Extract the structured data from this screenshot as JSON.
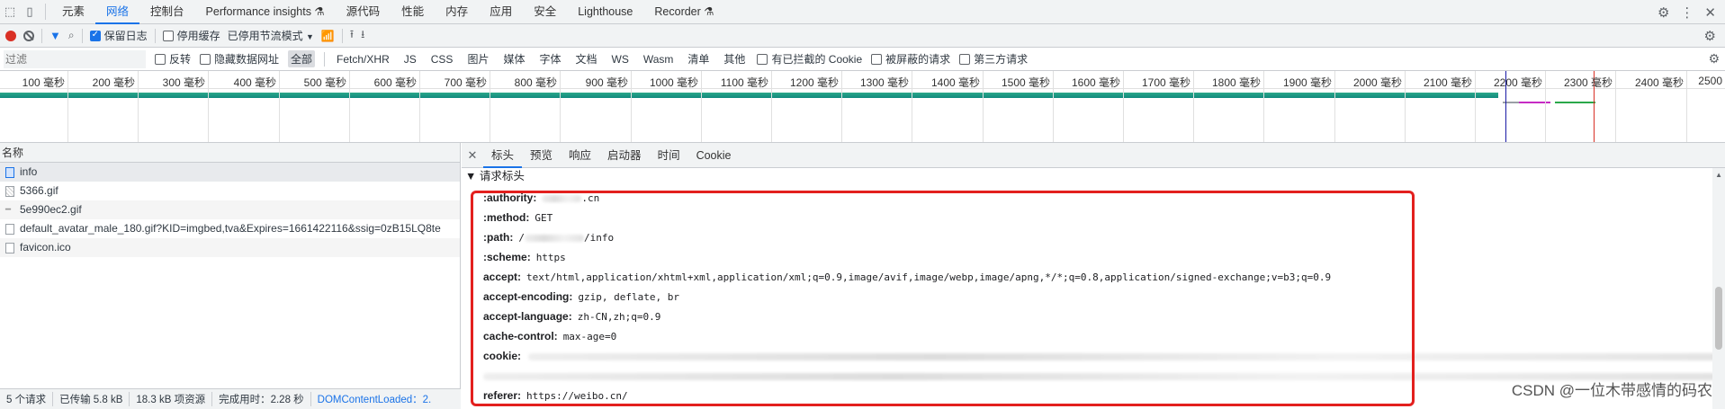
{
  "top_tabs": [
    "元素",
    "网络",
    "控制台",
    "Performance insights ⚗",
    "源代码",
    "性能",
    "内存",
    "应用",
    "安全",
    "Lighthouse",
    "Recorder ⚗"
  ],
  "active_top_tab": "网络",
  "toolbar": {
    "preserve_log": "保留日志",
    "disable_cache": "停用缓存",
    "throttle": "已停用节流模式"
  },
  "filter": {
    "placeholder": "过滤",
    "invert": "反转",
    "hide_data_urls": "隐藏数据网址",
    "types": [
      "全部",
      "Fetch/XHR",
      "JS",
      "CSS",
      "图片",
      "媒体",
      "字体",
      "文档",
      "WS",
      "Wasm",
      "清单",
      "其他"
    ],
    "blocked_cookies": "有已拦截的 Cookie",
    "blocked_requests": "被屏蔽的请求",
    "third_party": "第三方请求"
  },
  "timeline": {
    "ticks": [
      "100 毫秒",
      "200 毫秒",
      "300 毫秒",
      "400 毫秒",
      "500 毫秒",
      "600 毫秒",
      "700 毫秒",
      "800 毫秒",
      "900 毫秒",
      "1000 毫秒",
      "1100 毫秒",
      "1200 毫秒",
      "1300 毫秒",
      "1400 毫秒",
      "1500 毫秒",
      "1600 毫秒",
      "1700 毫秒",
      "1800 毫秒",
      "1900 毫秒",
      "2000 毫秒",
      "2100 毫秒",
      "2200 毫秒",
      "2300 毫秒",
      "2400 毫秒",
      "2500"
    ],
    "colors": {
      "main_bar": "#118a7e",
      "domcontentloaded": "#1a1aa6",
      "load": "#d93025"
    }
  },
  "requests": {
    "header": "名称",
    "items": [
      {
        "name": "info",
        "icon": "doc"
      },
      {
        "name": "5366.gif",
        "icon": "img"
      },
      {
        "name": "5e990ec2.gif",
        "icon": "gif2"
      },
      {
        "name": "default_avatar_male_180.gif?KID=imgbed,tva&Expires=1661422116&ssig=0zB15LQ8te",
        "icon": "blank"
      },
      {
        "name": "favicon.ico",
        "icon": "blank"
      }
    ]
  },
  "status": {
    "requests": "5 个请求",
    "transferred": "已传输 5.8 kB",
    "resources": "18.3 kB 项资源",
    "finish": "完成用时：2.28 秒",
    "dcl": "DOMContentLoaded：2."
  },
  "detail_tabs": [
    "标头",
    "预览",
    "响应",
    "启动器",
    "时间",
    "Cookie"
  ],
  "active_detail_tab": "标头",
  "section_title": "▼ 请求标头",
  "headers": [
    {
      "name": ":authority:",
      "value": ".cn"
    },
    {
      "name": ":method:",
      "value": "GET"
    },
    {
      "name": ":path:",
      "value": "/",
      "value2": "/info"
    },
    {
      "name": ":scheme:",
      "value": "https"
    },
    {
      "name": "accept:",
      "value": "text/html,application/xhtml+xml,application/xml;q=0.9,image/avif,image/webp,image/apng,*/*;q=0.8,application/signed-exchange;v=b3;q=0.9"
    },
    {
      "name": "accept-encoding:",
      "value": "gzip, deflate, br"
    },
    {
      "name": "accept-language:",
      "value": "zh-CN,zh;q=0.9"
    },
    {
      "name": "cache-control:",
      "value": "max-age=0"
    },
    {
      "name": "cookie:",
      "value": ""
    },
    {
      "name": "",
      "value": ""
    },
    {
      "name": "referer:",
      "value": "https://weibo.cn/"
    }
  ],
  "watermark": "CSDN @一位木带感情的码农"
}
